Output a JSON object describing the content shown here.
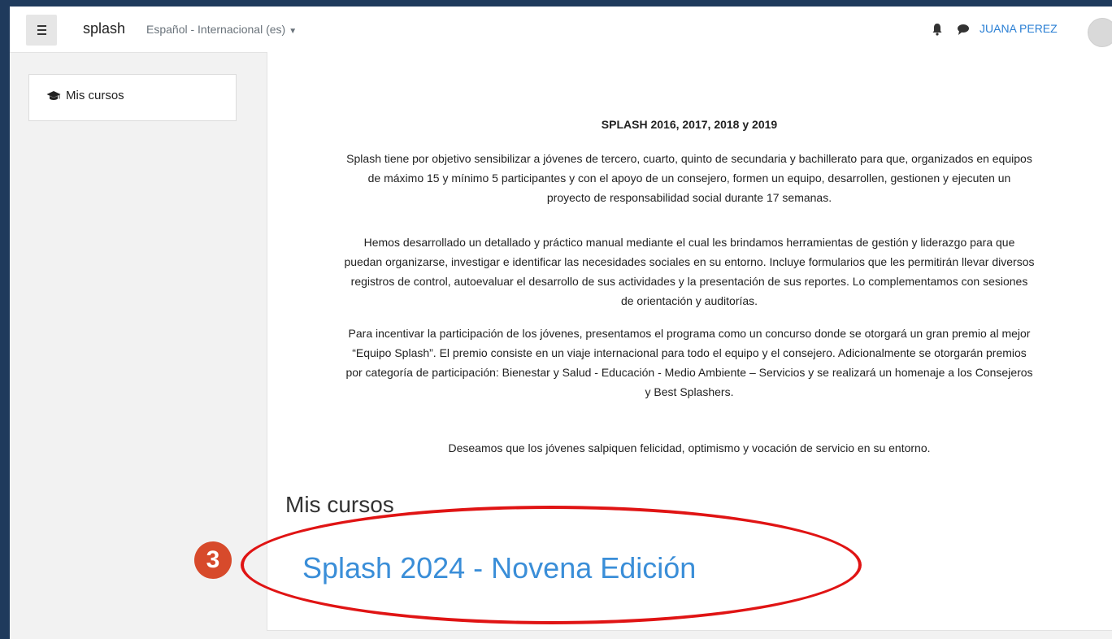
{
  "navbar": {
    "brand": "splash",
    "language": "Español - Internacional (es)",
    "user": "JUANA PEREZ"
  },
  "sidebar": {
    "items": [
      {
        "label": "Mis cursos",
        "icon": "graduation-cap-icon"
      }
    ]
  },
  "main": {
    "heading": "SPLASH 2016, 2017, 2018 y 2019",
    "paragraphs": [
      [
        "Splash tiene por objetivo sensibilizar a jóvenes de tercero, cuarto, quinto de secundaria y bachillerato para que, organizados en equipos",
        "de máximo 15 y mínimo 5 participantes y con el apoyo de un consejero, formen un equipo, desarrollen, gestionen y ejecuten un",
        "proyecto de responsabilidad social durante 17 semanas."
      ],
      [
        "Hemos desarrollado un detallado y práctico manual mediante el cual les brindamos herramientas de gestión y liderazgo para que",
        "puedan organizarse, investigar e identificar las necesidades sociales en su entorno. Incluye formularios que les permitirán llevar diversos",
        "registros de control, autoevaluar el desarrollo de sus actividades y la presentación de sus reportes. Lo complementamos con sesiones",
        "de orientación y auditorías."
      ],
      [
        "Para incentivar la participación de los jóvenes, presentamos el programa como un concurso donde se otorgará un gran premio al mejor",
        "“Equipo Splash”. El premio consiste en un viaje internacional para todo el equipo y el consejero.  Adicionalmente se otorgarán premios",
        "por categoría de participación: Bienestar y Salud - Educación - Medio Ambiente – Servicios y se realizará un homenaje a los Consejeros",
        "y Best Splashers."
      ],
      [
        "Deseamos que los jóvenes salpiquen felicidad, optimismo y vocación de servicio en su entorno."
      ]
    ],
    "courses_title": "Mis cursos",
    "courses": [
      {
        "name": "Splash 2024 - Novena Edición"
      }
    ]
  },
  "annotation": {
    "badge": "3",
    "color": "#e01414"
  },
  "colors": {
    "link": "#3a8ed8",
    "background": "#1f3a5c",
    "badge": "#d74a2b"
  }
}
